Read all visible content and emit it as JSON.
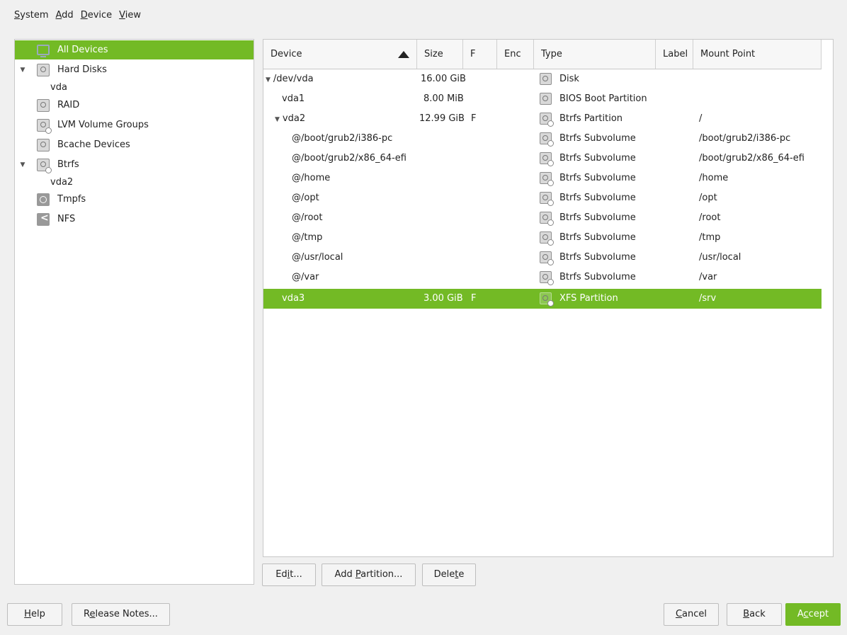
{
  "menu": [
    {
      "pre": "",
      "ul": "S",
      "post": "ystem"
    },
    {
      "pre": "",
      "ul": "A",
      "post": "dd"
    },
    {
      "pre": "",
      "ul": "D",
      "post": "evice"
    },
    {
      "pre": "",
      "ul": "V",
      "post": "iew"
    }
  ],
  "tree": [
    {
      "label": "All Devices",
      "icon": "monitor-icon"
    },
    {
      "label": "Hard Disks",
      "icon": "disk-icon"
    },
    {
      "label": "vda"
    },
    {
      "label": "RAID",
      "icon": "disk-icon"
    },
    {
      "label": "LVM Volume Groups",
      "icon": "disk-icon"
    },
    {
      "label": "Bcache Devices",
      "icon": "disk-icon"
    },
    {
      "label": "Btrfs",
      "icon": "disk-icon"
    },
    {
      "label": "vda2"
    },
    {
      "label": "Tmpfs",
      "icon": "clock-icon"
    },
    {
      "label": "NFS",
      "icon": "share-icon"
    }
  ],
  "columns": [
    "Device",
    "Size",
    "F",
    "Enc",
    "Type",
    "Label",
    "Mount Point"
  ],
  "rows": [
    {
      "device": "/dev/vda",
      "size": "16.00 GiB",
      "f": "",
      "enc": "",
      "type": "Disk",
      "label": "",
      "mount": ""
    },
    {
      "device": "vda1",
      "size": "8.00 MiB",
      "f": "",
      "enc": "",
      "type": "BIOS Boot Partition",
      "label": "",
      "mount": ""
    },
    {
      "device": "vda2",
      "size": "12.99 GiB",
      "f": "F",
      "enc": "",
      "type": "Btrfs Partition",
      "label": "",
      "mount": "/"
    },
    {
      "device": "@/boot/grub2/i386-pc",
      "size": "",
      "f": "",
      "enc": "",
      "type": "Btrfs Subvolume",
      "label": "",
      "mount": "/boot/grub2/i386-pc"
    },
    {
      "device": "@/boot/grub2/x86_64-efi",
      "size": "",
      "f": "",
      "enc": "",
      "type": "Btrfs Subvolume",
      "label": "",
      "mount": "/boot/grub2/x86_64-efi"
    },
    {
      "device": "@/home",
      "size": "",
      "f": "",
      "enc": "",
      "type": "Btrfs Subvolume",
      "label": "",
      "mount": "/home"
    },
    {
      "device": "@/opt",
      "size": "",
      "f": "",
      "enc": "",
      "type": "Btrfs Subvolume",
      "label": "",
      "mount": "/opt"
    },
    {
      "device": "@/root",
      "size": "",
      "f": "",
      "enc": "",
      "type": "Btrfs Subvolume",
      "label": "",
      "mount": "/root"
    },
    {
      "device": "@/tmp",
      "size": "",
      "f": "",
      "enc": "",
      "type": "Btrfs Subvolume",
      "label": "",
      "mount": "/tmp"
    },
    {
      "device": "@/usr/local",
      "size": "",
      "f": "",
      "enc": "",
      "type": "Btrfs Subvolume",
      "label": "",
      "mount": "/usr/local"
    },
    {
      "device": "@/var",
      "size": "",
      "f": "",
      "enc": "",
      "type": "Btrfs Subvolume",
      "label": "",
      "mount": "/var"
    },
    {
      "device": "vda3",
      "size": "3.00 GiB",
      "f": "F",
      "enc": "",
      "type": "XFS Partition",
      "label": "",
      "mount": "/srv"
    }
  ],
  "table_buttons": {
    "edit": {
      "pre": "Ed",
      "ul": "i",
      "post": "t..."
    },
    "add_partition": {
      "pre": "Add ",
      "ul": "P",
      "post": "artition..."
    },
    "delete": {
      "pre": "Dele",
      "ul": "t",
      "post": "e"
    }
  },
  "footer": {
    "help": {
      "pre": "",
      "ul": "H",
      "post": "elp"
    },
    "release_notes": {
      "pre": "R",
      "ul": "e",
      "post": "lease Notes..."
    },
    "cancel": {
      "pre": "",
      "ul": "C",
      "post": "ancel"
    },
    "back": {
      "pre": "",
      "ul": "B",
      "post": "ack"
    },
    "accept": {
      "pre": "A",
      "ul": "c",
      "post": "cept"
    }
  },
  "colors": {
    "accent": "#73ba25"
  }
}
